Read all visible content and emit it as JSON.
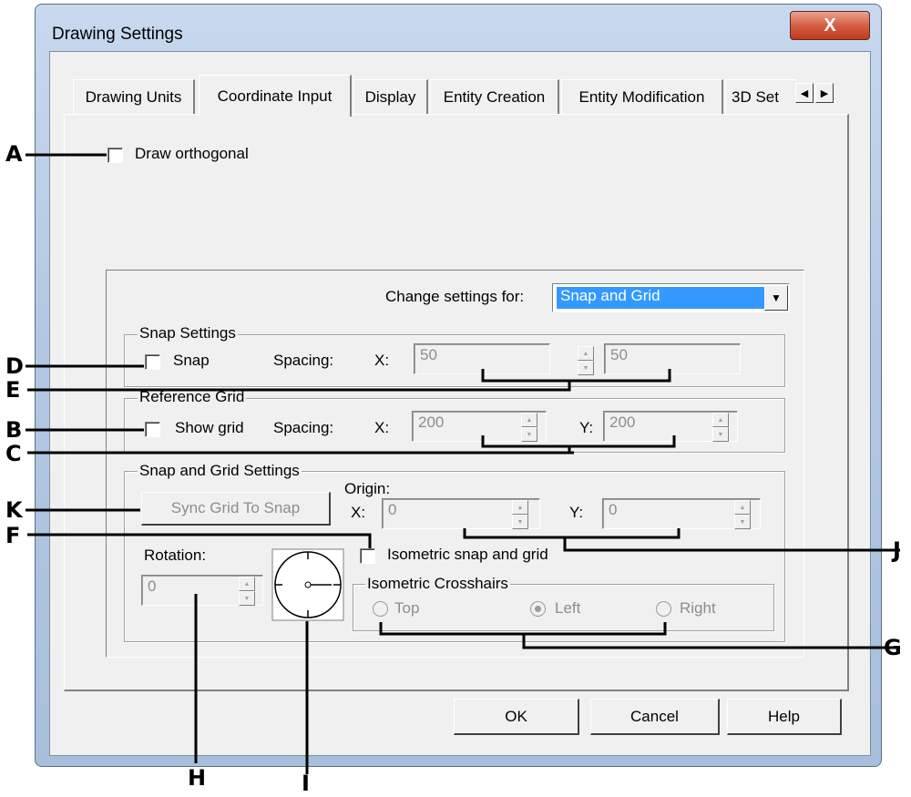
{
  "window": {
    "title": "Drawing Settings",
    "close_glyph": "X"
  },
  "tabs": [
    {
      "label": "Drawing Units",
      "active": false
    },
    {
      "label": "Coordinate Input",
      "active": true
    },
    {
      "label": "Display",
      "active": false
    },
    {
      "label": "Entity Creation",
      "active": false
    },
    {
      "label": "Entity Modification",
      "active": false
    },
    {
      "label": "3D Set",
      "active": false
    }
  ],
  "tab_scroll": {
    "left_glyph": "◀",
    "right_glyph": "▶"
  },
  "draw_orthogonal": {
    "label": "Draw orthogonal",
    "checked": false
  },
  "change_settings": {
    "label": "Change settings for:",
    "value": "Snap and Grid",
    "arrow_glyph": "▼"
  },
  "snap_settings": {
    "legend": "Snap Settings",
    "snap_label": "Snap",
    "snap_checked": false,
    "spacing_label": "Spacing:",
    "x_label": "X:",
    "x_value": "50",
    "y_value": "50"
  },
  "reference_grid": {
    "legend": "Reference Grid",
    "show_grid_label": "Show grid",
    "show_grid_checked": false,
    "spacing_label": "Spacing:",
    "x_label": "X:",
    "x_value": "200",
    "y_label": "Y:",
    "y_value": "200"
  },
  "snap_grid_settings": {
    "legend": "Snap and Grid Settings",
    "sync_button": "Sync Grid To Snap",
    "origin_label": "Origin:",
    "x_label": "X:",
    "x_value": "0",
    "y_label": "Y:",
    "y_value": "0",
    "isometric_label": "Isometric snap and grid",
    "isometric_checked": false,
    "rotation_label": "Rotation:",
    "rotation_value": "0"
  },
  "isometric_crosshairs": {
    "legend": "Isometric Crosshairs",
    "options": [
      {
        "label": "Top",
        "checked": false
      },
      {
        "label": "Left",
        "checked": true
      },
      {
        "label": "Right",
        "checked": false
      }
    ]
  },
  "buttons": {
    "ok": "OK",
    "cancel": "Cancel",
    "help": "Help"
  },
  "callouts": [
    "A",
    "B",
    "C",
    "D",
    "E",
    "F",
    "G",
    "H",
    "I",
    "J",
    "K"
  ]
}
